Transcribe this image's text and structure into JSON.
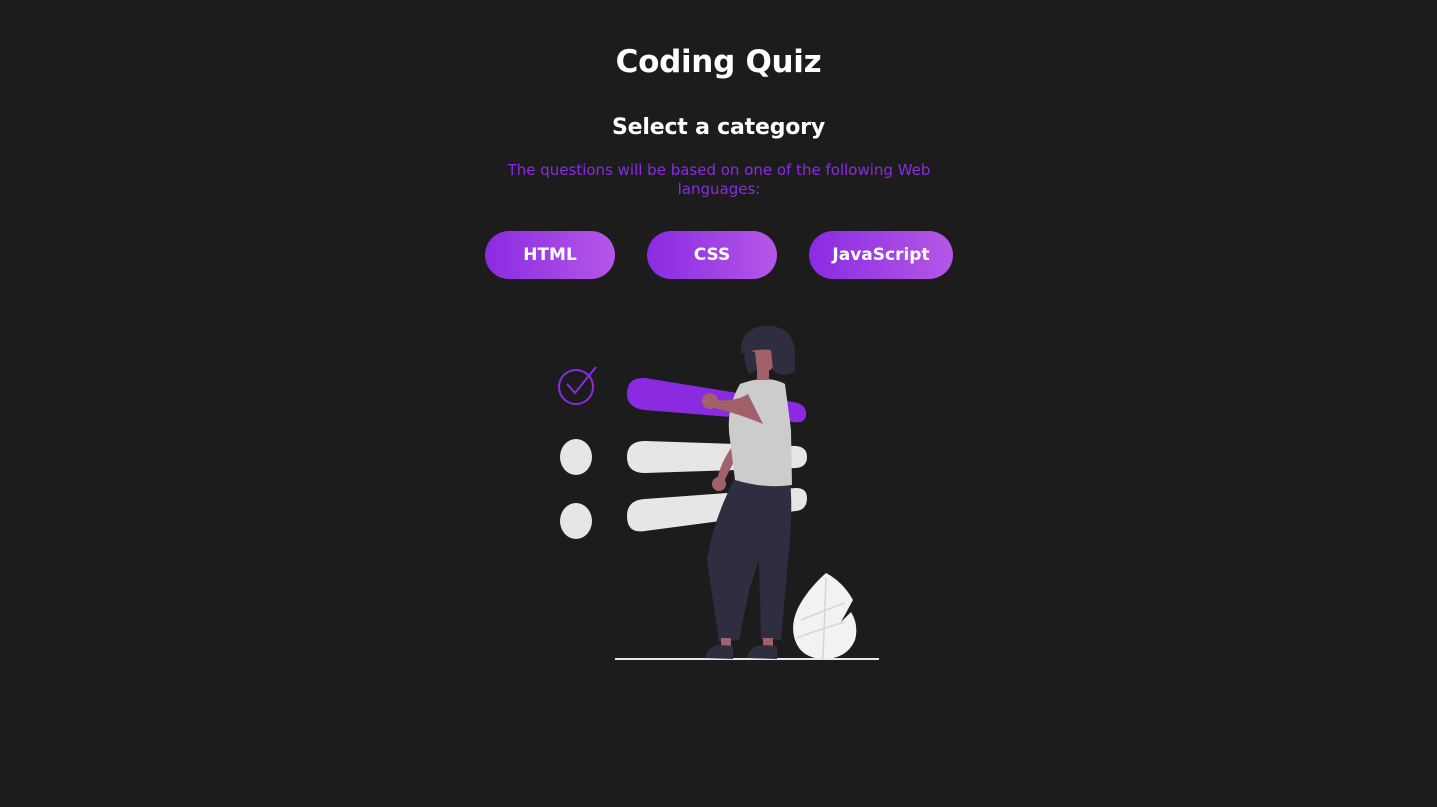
{
  "header": {
    "title": "Coding Quiz",
    "subtitle": "Select a category",
    "description": "The questions will be based on one of the following Web languages:"
  },
  "categories": [
    {
      "label": "HTML"
    },
    {
      "label": "CSS"
    },
    {
      "label": "JavaScript"
    }
  ],
  "colors": {
    "background": "#1c1c1c",
    "accent": "#8a2be2",
    "accent_light": "#b557e6",
    "text": "#ffffff"
  },
  "illustration": {
    "icons": [
      "check-circle-icon",
      "empty-circle-icon",
      "empty-circle-icon",
      "leaf-plant-icon",
      "person-figure"
    ]
  }
}
